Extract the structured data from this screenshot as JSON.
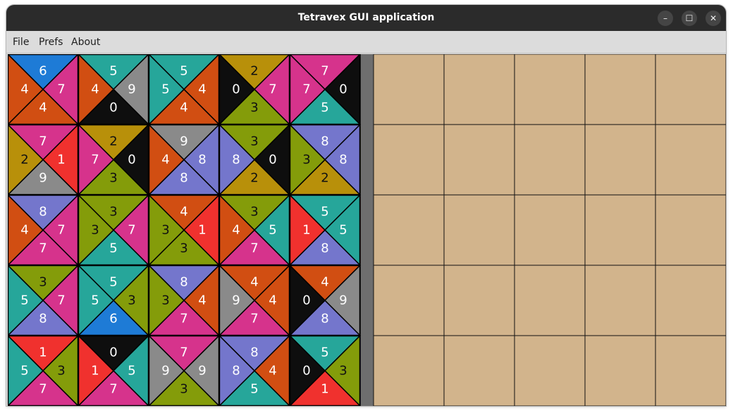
{
  "window": {
    "title": "Tetravex GUI application",
    "controls": {
      "minimize_glyph": "–",
      "maximize_glyph": "☐",
      "close_glyph": "✕"
    }
  },
  "menu": [
    "File",
    "Prefs",
    "About"
  ],
  "game": {
    "size": 5,
    "colors": {
      "0": "#0e0e0e",
      "1": "#f0312e",
      "2": "#b8900a",
      "3": "#849c0a",
      "4": "#d14e12",
      "5": "#26a69a",
      "6": "#1e7bd6",
      "7": "#d6338c",
      "8": "#7476cc",
      "9": "#8a8a8a"
    },
    "text_colors": {
      "light": "#ffffff",
      "dark": "#111111",
      "dark_on": [
        2,
        3
      ]
    },
    "tray_color": "#d2b48c",
    "tray_line_color": "#111111",
    "tiles": [
      [
        [
          6,
          7,
          4,
          4
        ],
        [
          5,
          9,
          0,
          4
        ],
        [
          5,
          4,
          4,
          5
        ],
        [
          2,
          7,
          3,
          0
        ],
        [
          7,
          0,
          5,
          7
        ]
      ],
      [
        [
          7,
          1,
          9,
          2
        ],
        [
          2,
          0,
          3,
          7
        ],
        [
          9,
          8,
          8,
          4
        ],
        [
          3,
          0,
          2,
          8
        ],
        [
          8,
          8,
          2,
          3
        ]
      ],
      [
        [
          8,
          7,
          7,
          4
        ],
        [
          3,
          7,
          5,
          3
        ],
        [
          4,
          1,
          3,
          3
        ],
        [
          3,
          5,
          7,
          4
        ],
        [
          5,
          5,
          8,
          1
        ]
      ],
      [
        [
          3,
          7,
          8,
          5
        ],
        [
          5,
          3,
          6,
          5
        ],
        [
          8,
          4,
          7,
          3
        ],
        [
          4,
          4,
          7,
          9
        ],
        [
          4,
          9,
          8,
          0
        ]
      ],
      [
        [
          1,
          3,
          7,
          5
        ],
        [
          0,
          5,
          7,
          1
        ],
        [
          7,
          9,
          3,
          9
        ],
        [
          8,
          4,
          5,
          8
        ],
        [
          5,
          3,
          1,
          0
        ]
      ]
    ]
  }
}
